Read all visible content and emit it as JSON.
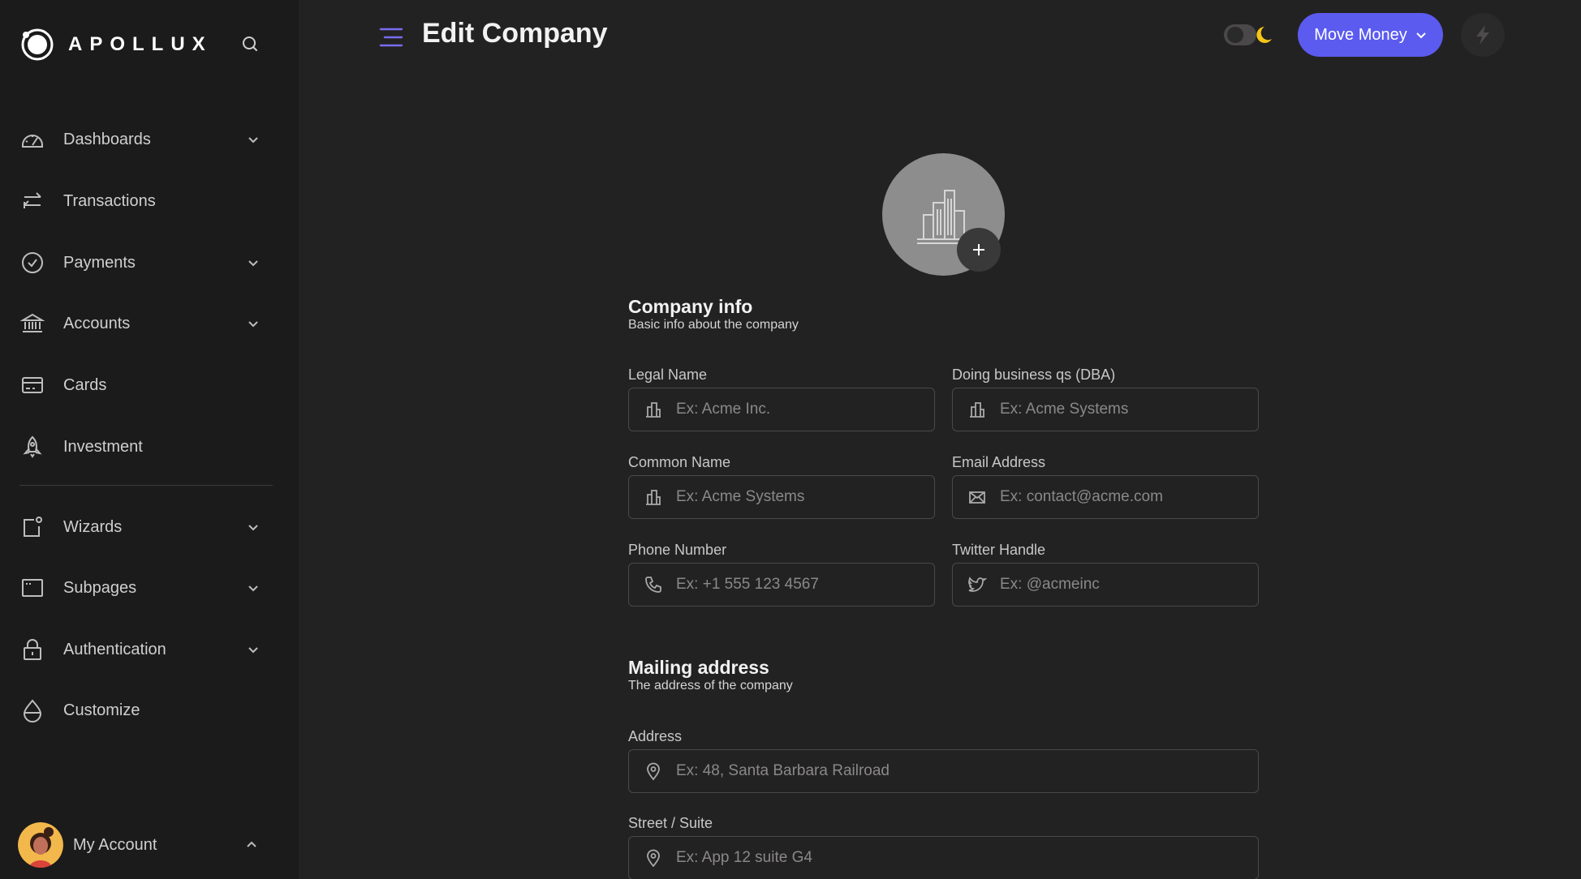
{
  "brand": {
    "name": "APOLLUX"
  },
  "sidebar": {
    "items": [
      {
        "label": "Dashboards",
        "icon": "gauge-icon",
        "expandable": true
      },
      {
        "label": "Transactions",
        "icon": "arrows-exchange-icon",
        "expandable": false
      },
      {
        "label": "Payments",
        "icon": "check-circle-icon",
        "expandable": true
      },
      {
        "label": "Accounts",
        "icon": "bank-icon",
        "expandable": true
      },
      {
        "label": "Cards",
        "icon": "credit-card-icon",
        "expandable": false
      },
      {
        "label": "Investment",
        "icon": "rocket-icon",
        "expandable": false
      },
      {
        "label": "Wizards",
        "icon": "wizard-icon",
        "expandable": true
      },
      {
        "label": "Subpages",
        "icon": "browser-window-icon",
        "expandable": true
      },
      {
        "label": "Authentication",
        "icon": "lock-icon",
        "expandable": true
      },
      {
        "label": "Customize",
        "icon": "droplet-icon",
        "expandable": false
      }
    ],
    "account": {
      "label": "My Account"
    }
  },
  "header": {
    "title": "Edit Company",
    "move_money_label": "Move Money"
  },
  "company_info": {
    "title": "Company info",
    "subtitle": "Basic info about the company",
    "fields": {
      "legal_name": {
        "label": "Legal Name",
        "placeholder": "Ex: Acme Inc.",
        "value": ""
      },
      "dba": {
        "label": "Doing business qs (DBA)",
        "placeholder": "Ex: Acme Systems",
        "value": ""
      },
      "common_name": {
        "label": "Common Name",
        "placeholder": "Ex: Acme Systems",
        "value": ""
      },
      "email": {
        "label": "Email Address",
        "placeholder": "Ex: contact@acme.com",
        "value": ""
      },
      "phone": {
        "label": "Phone Number",
        "placeholder": "Ex: +1 555 123 4567",
        "value": ""
      },
      "twitter": {
        "label": "Twitter Handle",
        "placeholder": "Ex: @acmeinc",
        "value": ""
      }
    }
  },
  "mailing_address": {
    "title": "Mailing address",
    "subtitle": "The address of the company",
    "fields": {
      "address": {
        "label": "Address",
        "placeholder": "Ex: 48, Santa Barbara Railroad",
        "value": ""
      },
      "street": {
        "label": "Street / Suite",
        "placeholder": "Ex: App 12 suite G4",
        "value": ""
      }
    }
  },
  "colors": {
    "accent": "#5b5bf0",
    "background": "#232222",
    "sidebar": "#1c1b1b",
    "moon": "#f5c518"
  }
}
